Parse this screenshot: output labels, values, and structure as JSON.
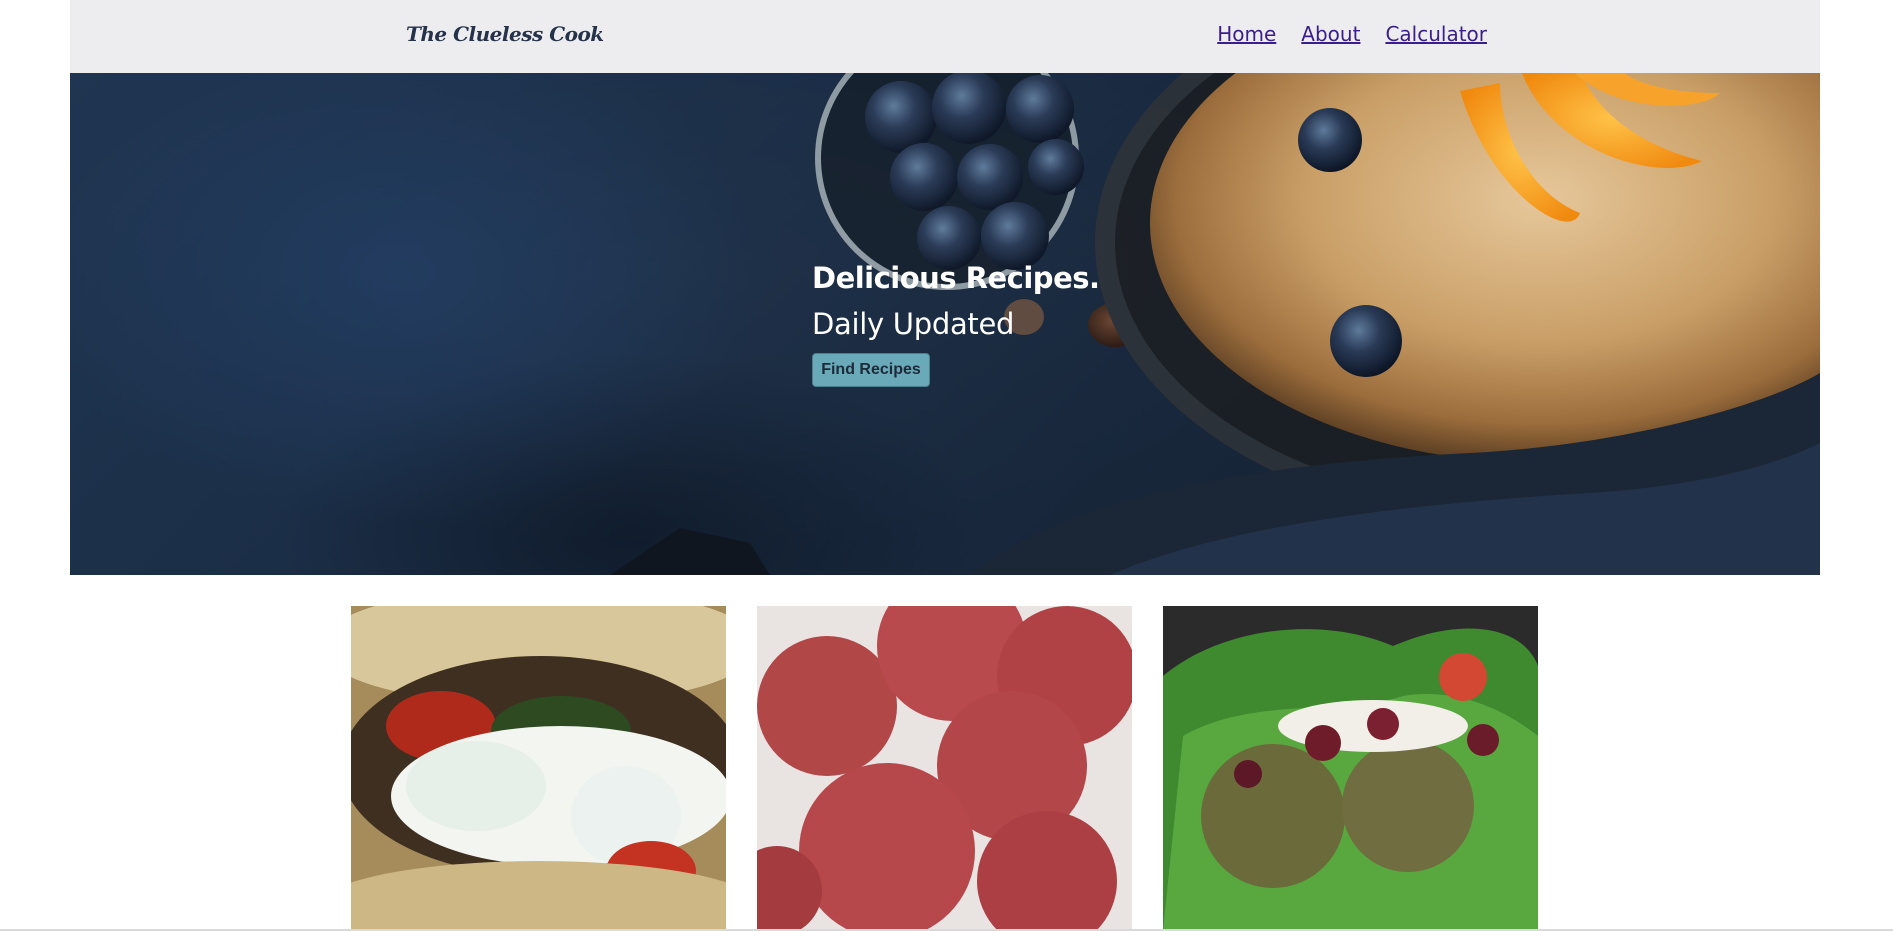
{
  "navbar": {
    "brand": "The Clueless Cook",
    "links": [
      {
        "label": "Home"
      },
      {
        "label": "About"
      },
      {
        "label": "Calculator"
      }
    ]
  },
  "hero": {
    "title": "Delicious Recipes.",
    "subtitle": "Daily Updated",
    "button_label": "Find Recipes"
  },
  "colors": {
    "navbar_bg": "#ededef",
    "brand_text": "#25324a",
    "link": "#3a1f8a",
    "hero_bg": "#1a2c44",
    "button_bg": "#6aa9b8"
  },
  "cards": [
    {
      "image": "gyro-wrap-photo"
    },
    {
      "image": "beet-falafel-photo"
    },
    {
      "image": "falafel-lettuce-photo"
    }
  ]
}
